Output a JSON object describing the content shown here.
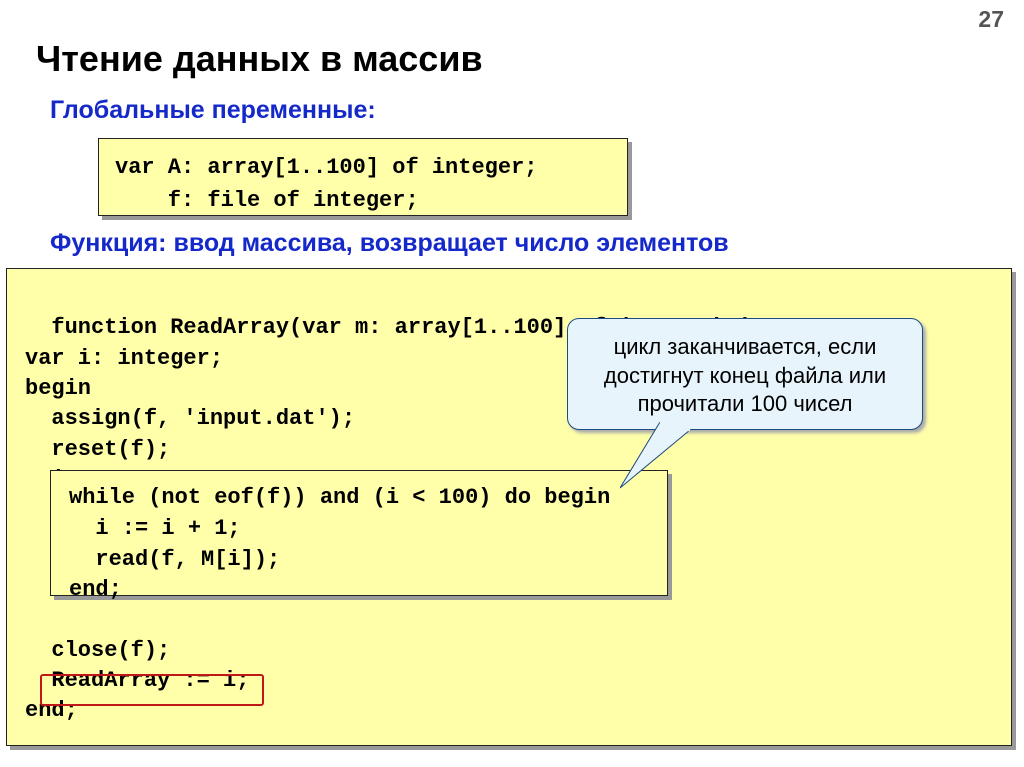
{
  "page_number": "27",
  "title": "Чтение данных в массив",
  "subtitle_globals": "Глобальные переменные:",
  "code_globals": "var A: array[1..100] of integer;\n    f: file of integer;",
  "subtitle_function": "Функция: ввод массива, возвращает число элементов",
  "code_main_top": "function ReadArray(var m: array[1..100] of integer):integer;\nvar i: integer;\nbegin\n  assign(f, 'input.dat');\n  reset(f);\n  i := 0;",
  "code_inner": "while (not eof(f)) and (i < 100) do begin\n  i := i + 1;\n  read(f, M[i]);\nend;",
  "code_main_bottom": "  close(f);\n  ReadArray := i;\nend;",
  "callout_text": "цикл заканчивается, если достигнут конец файла или прочитали 100 чисел"
}
